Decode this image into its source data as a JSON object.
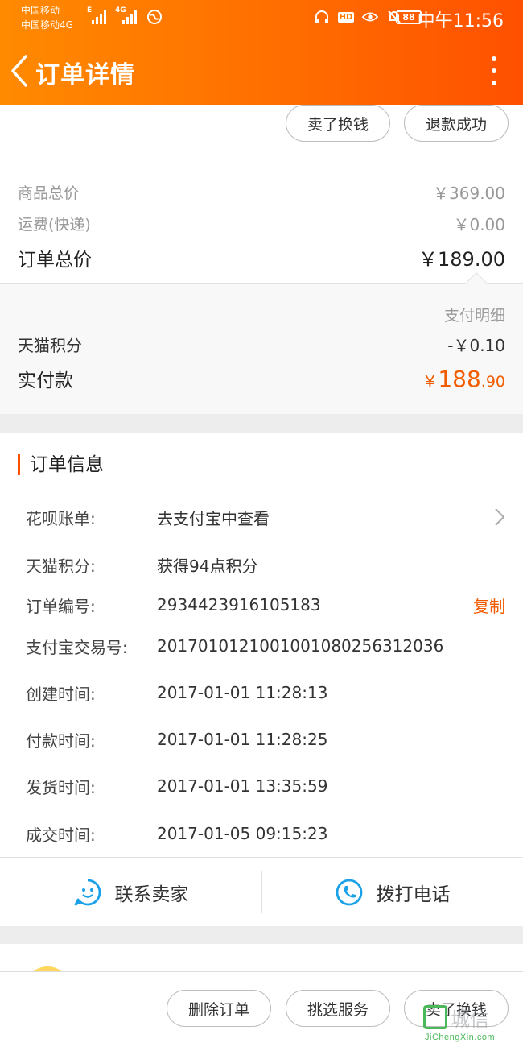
{
  "status_bar": {
    "carrier_1": "中国移动",
    "carrier_2": "中国移动4G",
    "net_1": "E",
    "net_2": "4G",
    "hd_badge": "HD",
    "battery": "88",
    "time": "中午11:56"
  },
  "header": {
    "title": "订单详情"
  },
  "top_actions": {
    "sell_exchange": "卖了换钱",
    "refund_status": "退款成功"
  },
  "price_summary": {
    "goods_total_label": "商品总价",
    "goods_total_value": "￥369.00",
    "shipping_label": "运费(快递)",
    "shipping_value": "￥0.00",
    "order_total_label": "订单总价",
    "order_total_value": "￥189.00"
  },
  "payment": {
    "detail_link": "支付明细",
    "points_label": "天猫积分",
    "points_value": "-￥0.10",
    "paid_label": "实付款",
    "paid_currency": "￥",
    "paid_integer": "188",
    "paid_decimal": ".90"
  },
  "order_info": {
    "section_title": "订单信息",
    "rows": [
      {
        "label": "花呗账单:",
        "value": "去支付宝中查看"
      },
      {
        "label": "天猫积分:",
        "value": "获得94点积分"
      },
      {
        "label": "订单编号:",
        "value": "2934423916105183",
        "action": "复制"
      },
      {
        "label": "支付宝交易号:",
        "value": "2017010121001001080256312036"
      },
      {
        "label": "创建时间:",
        "value": "2017-01-01 11:28:13"
      },
      {
        "label": "付款时间:",
        "value": "2017-01-01 11:28:25"
      },
      {
        "label": "发货时间:",
        "value": "2017-01-01 13:35:59"
      },
      {
        "label": "成交时间:",
        "value": "2017-01-05 09:15:23"
      }
    ]
  },
  "contact": {
    "seller": "联系卖家",
    "phone": "拨打电话"
  },
  "bottom_actions": {
    "delete": "删除订单",
    "select_service": "挑选服务",
    "sell_exchange": "卖了换钱"
  },
  "watermark": {
    "text": "城信",
    "url": "JiChengXin.com"
  },
  "colors": {
    "brand_orange": "#ff6a00",
    "price_orange": "#f25c00",
    "icon_blue": "#1aa1e8"
  }
}
